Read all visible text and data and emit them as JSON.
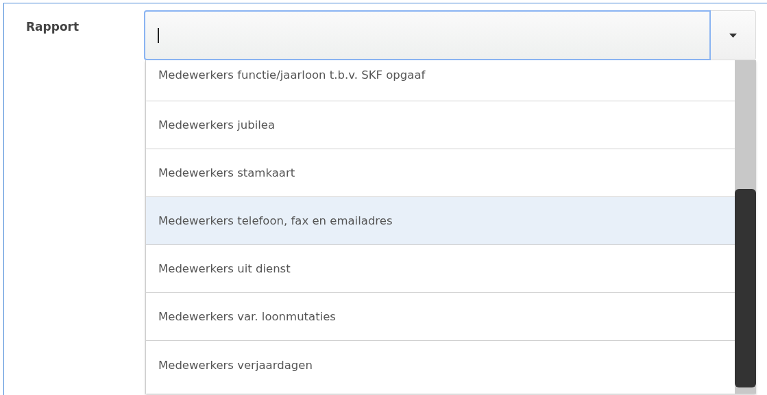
{
  "form": {
    "label": "Rapport",
    "combobox": {
      "focused": true,
      "expanded": true
    }
  },
  "options": [
    {
      "label": "Medewerkers functie/jaarloon t.b.v. SKF opgaaf",
      "selected": false
    },
    {
      "label": "Medewerkers jubilea",
      "selected": false
    },
    {
      "label": "Medewerkers stamkaart",
      "selected": false
    },
    {
      "label": "Medewerkers telefoon, fax en emailadres",
      "selected": true
    },
    {
      "label": "Medewerkers uit dienst",
      "selected": false
    },
    {
      "label": "Medewerkers var. loonmutaties",
      "selected": false
    },
    {
      "label": "Medewerkers verjaardagen",
      "selected": false
    }
  ]
}
